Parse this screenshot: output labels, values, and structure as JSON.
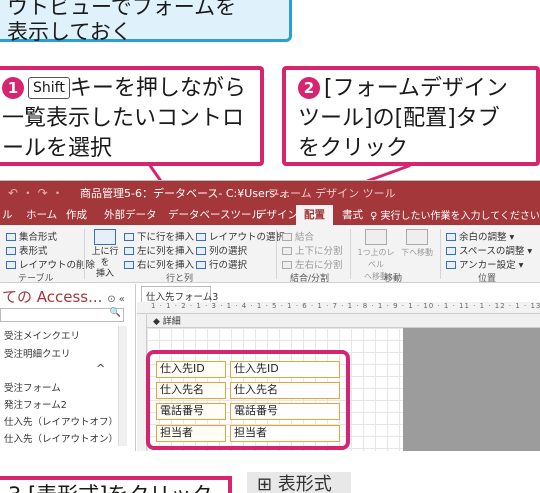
{
  "callout_top": {
    "line1": "ウトビューでフォームを",
    "line2": "表示しておく"
  },
  "step1": {
    "number": "1",
    "key": "Shift",
    "line1_after": "キーを押しながら",
    "line2": "一覧表示したいコントロ",
    "line3": "ールを選択"
  },
  "step2": {
    "number": "2",
    "line1": "[フォームデザイン",
    "line2": "ツール]の[配置]タブ",
    "line3": "をクリック"
  },
  "window": {
    "title": "商品管理5-6：データベース- C:¥Users-…",
    "context_title": "フォーム デザイン ツール",
    "quick_access": "↶ ・ ↷ ・",
    "tabs": [
      "ル",
      "ホーム",
      "作成",
      "外部データ",
      "データベースツール",
      "デザイン",
      "配置",
      "書式"
    ],
    "active_tab": "配置",
    "tell_me": "♀ 実行したい作業を入力してください"
  },
  "ribbon": {
    "table_group": {
      "items": [
        "集合形式",
        "表形式",
        "レイアウトの削除"
      ],
      "label": "テーブル"
    },
    "rows_cols_group": {
      "big_button": "上に行を\n挿入",
      "items": [
        "下に行を挿入",
        "左に列を挿入",
        "右に列を挿入",
        "レイアウトの選択",
        "列の選択",
        "行の選択"
      ],
      "label": "行と列"
    },
    "merge_group": {
      "items": [
        "結合",
        "上下に分割",
        "左右に分割"
      ],
      "label": "結合/分割"
    },
    "move_group": {
      "items": [
        "1つ上のレベル\nへ移動",
        "下へ移動"
      ],
      "label": "移動"
    },
    "position_group": {
      "items": [
        "余白の調整 ▾",
        "スペースの調整 ▾",
        "アンカー設定 ▾"
      ],
      "label": "位置"
    }
  },
  "nav_pane": {
    "header": "ての Access...",
    "header_icons": "⊙ «",
    "search_icon": "🔍",
    "items": [
      "受注メインクエリ",
      "受注明細クエリ",
      "受注フォーム",
      "発注フォーム2",
      "仕入先（レイアウトオフ）",
      "仕入先（レイアウトオン）"
    ],
    "collapse_mark": "^"
  },
  "document": {
    "tab_label": "仕入先フォーム3",
    "ruler_text": "1 · 1 · 2 · 1 · 3 · 1 · 4 · 1 · 5 · 1 · 6 · 1 · 7 · 1 · 8 · 1 · 9 · 1 · 10 · 1 · 11 · 1 · 12 · 1 · 13 · 1 · 14",
    "section": "◆ 詳細",
    "rows": [
      {
        "label": "仕入先ID",
        "field": "仕入先ID"
      },
      {
        "label": "仕入先名",
        "field": "仕入先名"
      },
      {
        "label": "電話番号",
        "field": "電話番号"
      },
      {
        "label": "担当者",
        "field": "担当者"
      }
    ]
  },
  "bottom": {
    "instruction": "3 [表形式]をクリック",
    "chip": "⊞ 表形式"
  },
  "colors": {
    "accent_pink": "#d6246e",
    "access_red": "#a4373a",
    "callout_blue": "#2a9fd6",
    "control_orange": "#e8a33d"
  }
}
